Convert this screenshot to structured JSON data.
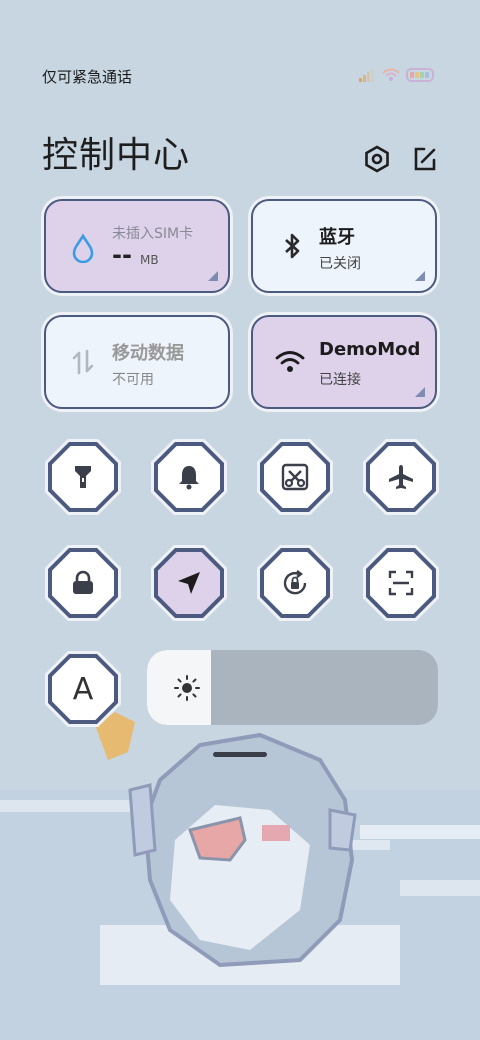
{
  "status_bar": {
    "carrier_text": "仅可紧急通话"
  },
  "header": {
    "title": "控制中心"
  },
  "cards": {
    "data_usage": {
      "label": "未插入SIM卡",
      "value": "--",
      "unit": "MB"
    },
    "bluetooth": {
      "title": "蓝牙",
      "status": "已关闭"
    },
    "mobile_data": {
      "title": "移动数据",
      "status": "不可用"
    },
    "wifi": {
      "title": "DemoMod",
      "status": "已连接"
    }
  },
  "toggles": {
    "font_letter": "A"
  },
  "brightness": {
    "level": 0.22
  },
  "colors": {
    "accent_purple": "#ddd2ea",
    "tile_white": "#eef4fb",
    "border": "#4c5a80",
    "background": "#c8d6e2"
  }
}
